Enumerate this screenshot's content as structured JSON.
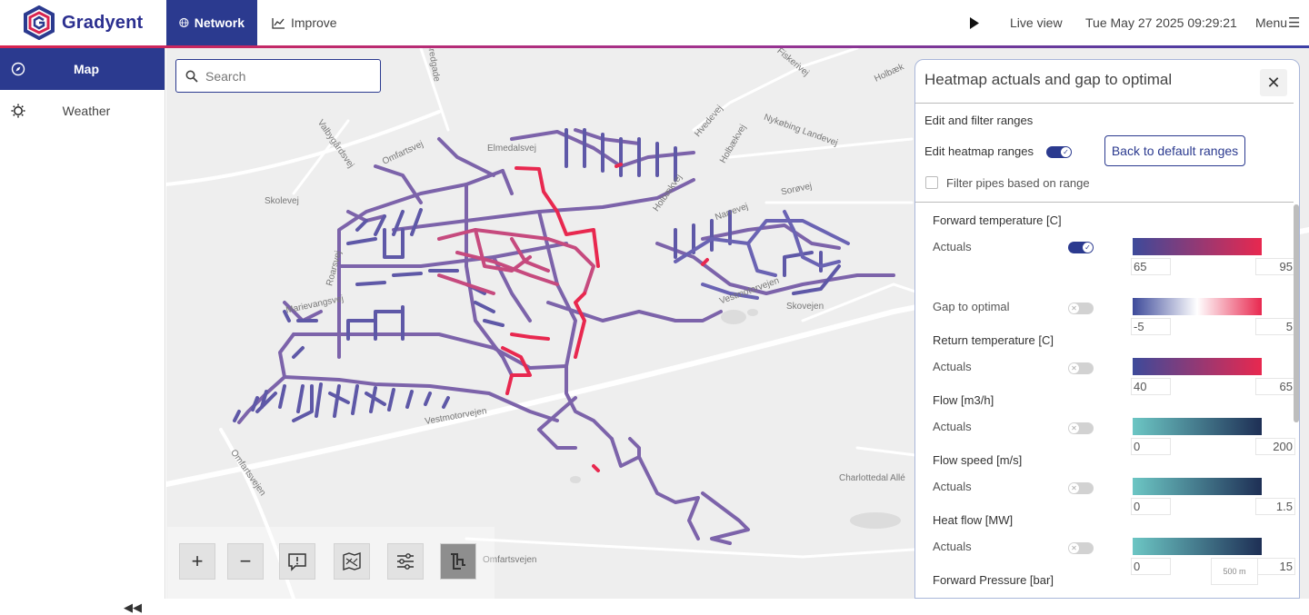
{
  "app": {
    "brand": "Gradyent",
    "nav": [
      {
        "label": "Network"
      },
      {
        "label": "Improve"
      }
    ],
    "live_label": "Live view",
    "datetime": "Tue May 27 2025 09:29:21",
    "menu_label": "Menu"
  },
  "sidebar": {
    "items": [
      {
        "label": "Map",
        "icon": "compass-icon"
      },
      {
        "label": "Weather",
        "icon": "sun-icon"
      }
    ],
    "collapse_icon": "double-chevron-left-icon"
  },
  "map": {
    "search_placeholder": "Search",
    "road_labels": [
      "Skolevej",
      "Omfartsvej",
      "Valbygårdsvej",
      "Elmedalsvej",
      "Marievangsvej",
      "Roarsvej",
      "Vestmotorvejen",
      "Vestmotorvejen",
      "Omfartsvejen",
      "Charlottedal Allé",
      "Omfartsvejen",
      "Skovejen",
      "Sorøvej",
      "Narrevej",
      "Holbækvej",
      "Hvedevej",
      "Nykøbing Landevej",
      "Fiskerivej",
      "Holbæk",
      "Holbækvej",
      "Bredgade"
    ],
    "scale_label": "500 m",
    "tools": [
      {
        "name": "zoom-in-button",
        "icon": "plus-icon"
      },
      {
        "name": "zoom-out-button",
        "icon": "minus-icon"
      },
      {
        "name": "alerts-button",
        "icon": "alert-message-icon"
      },
      {
        "name": "map-layers-button",
        "icon": "map-icon"
      },
      {
        "name": "filters-button",
        "icon": "sliders-icon"
      },
      {
        "name": "heatmap-button",
        "icon": "network-pipes-icon"
      }
    ]
  },
  "panel": {
    "title": "Heatmap actuals and gap to optimal",
    "edit_section": "Edit and filter ranges",
    "edit_toggle_label": "Edit heatmap ranges",
    "edit_toggle_on": true,
    "default_button": "Back to default ranges",
    "filter_label": "Filter pipes based on range",
    "sections": [
      {
        "title": "Forward temperature [C]",
        "rows": [
          {
            "label": "Actuals",
            "on": true,
            "min": "65",
            "max": "95",
            "colors": [
              "#3d4a9a",
              "#e8284f"
            ]
          },
          {
            "label": "Gap to optimal",
            "on": false,
            "min": "-5",
            "max": "5",
            "colors": [
              "#3d4a9a",
              "#ffffff",
              "#e8284f"
            ]
          }
        ]
      },
      {
        "title": "Return temperature [C]",
        "rows": [
          {
            "label": "Actuals",
            "on": false,
            "min": "40",
            "max": "65",
            "colors": [
              "#3d4a9a",
              "#e8284f"
            ]
          }
        ]
      },
      {
        "title": "Flow [m3/h]",
        "rows": [
          {
            "label": "Actuals",
            "on": false,
            "min": "0",
            "max": "200",
            "colors": [
              "#6cc6c4",
              "#1e2f55"
            ]
          }
        ]
      },
      {
        "title": "Flow speed [m/s]",
        "rows": [
          {
            "label": "Actuals",
            "on": false,
            "min": "0",
            "max": "1.5",
            "colors": [
              "#6cc6c4",
              "#1e2f55"
            ]
          }
        ]
      },
      {
        "title": "Heat flow [MW]",
        "rows": [
          {
            "label": "Actuals",
            "on": false,
            "min": "0",
            "max": "15",
            "colors": [
              "#6cc6c4",
              "#1e2f55"
            ]
          }
        ]
      },
      {
        "title": "Forward Pressure [bar]",
        "rows": []
      }
    ]
  },
  "colors": {
    "brand": "#2b3a8f",
    "pipe": "#7b62a9",
    "hot": "#e8284f"
  }
}
